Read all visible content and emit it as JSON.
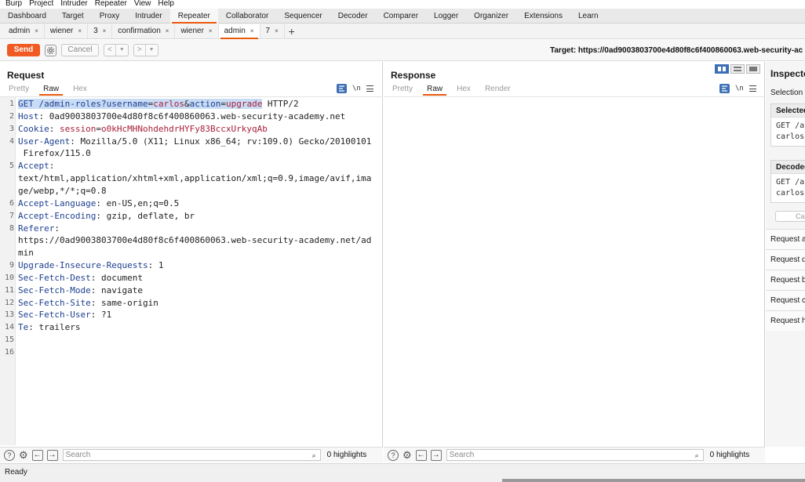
{
  "menu": [
    "Burp",
    "Project",
    "Intruder",
    "Repeater",
    "View",
    "Help"
  ],
  "main_tabs": [
    {
      "label": "Dashboard"
    },
    {
      "label": "Target"
    },
    {
      "label": "Proxy"
    },
    {
      "label": "Intruder"
    },
    {
      "label": "Repeater",
      "active": true
    },
    {
      "label": "Collaborator"
    },
    {
      "label": "Sequencer"
    },
    {
      "label": "Decoder"
    },
    {
      "label": "Comparer"
    },
    {
      "label": "Logger"
    },
    {
      "label": "Organizer"
    },
    {
      "label": "Extensions"
    },
    {
      "label": "Learn"
    }
  ],
  "sub_tabs": [
    {
      "label": "admin"
    },
    {
      "label": "wiener"
    },
    {
      "label": "3"
    },
    {
      "label": "confirmation"
    },
    {
      "label": "wiener"
    },
    {
      "label": "admin",
      "active": true
    },
    {
      "label": "7"
    }
  ],
  "toolbar": {
    "send_label": "Send",
    "cancel_label": "Cancel",
    "target_label": "Target: https://0ad9003803700e4d80f8c6f400860063.web-security-ac"
  },
  "request": {
    "title": "Request",
    "tabs": [
      "Pretty",
      "Raw",
      "Hex"
    ],
    "active_tab": "Raw",
    "lines": [
      {
        "n": "1",
        "parts": [
          {
            "t": "GET /admin-roles?",
            "c": "sel-key"
          },
          {
            "t": "username",
            "c": "sel-key"
          },
          {
            "t": "=",
            "c": "sel"
          },
          {
            "t": "carlos",
            "c": "sel-param"
          },
          {
            "t": "&",
            "c": "sel"
          },
          {
            "t": "action",
            "c": "sel-key"
          },
          {
            "t": "=",
            "c": "sel"
          },
          {
            "t": "upgrade",
            "c": "sel-param"
          },
          {
            "t": " HTTP/2",
            "c": "val"
          }
        ]
      },
      {
        "n": "2",
        "parts": [
          {
            "t": "Host",
            "c": "key"
          },
          {
            "t": ": 0ad9003803700e4d80f8c6f400860063.web-security-academy.net",
            "c": "val"
          }
        ]
      },
      {
        "n": "3",
        "parts": [
          {
            "t": "Cookie",
            "c": "key"
          },
          {
            "t": ": ",
            "c": "val"
          },
          {
            "t": "session",
            "c": "cookie"
          },
          {
            "t": "=",
            "c": "val"
          },
          {
            "t": "o0kHcMHNohdehdrHYFy83BccxUrkyqAb",
            "c": "cookie"
          }
        ]
      },
      {
        "n": "4",
        "parts": [
          {
            "t": "User-Agent",
            "c": "key"
          },
          {
            "t": ": Mozilla/5.0 (X11; Linux x86_64; rv:109.0) Gecko/20100101",
            "c": "val"
          }
        ]
      },
      {
        "n": "",
        "parts": [
          {
            "t": " Firefox/115.0",
            "c": "val"
          }
        ]
      },
      {
        "n": "5",
        "parts": [
          {
            "t": "Accept",
            "c": "key"
          },
          {
            "t": ":",
            "c": "val"
          }
        ]
      },
      {
        "n": "",
        "parts": [
          {
            "t": "text/html,application/xhtml+xml,application/xml;q=0.9,image/avif,ima",
            "c": "val"
          }
        ]
      },
      {
        "n": "",
        "parts": [
          {
            "t": "ge/webp,*/*;q=0.8",
            "c": "val"
          }
        ]
      },
      {
        "n": "6",
        "parts": [
          {
            "t": "Accept-Language",
            "c": "key"
          },
          {
            "t": ": en-US,en;q=0.5",
            "c": "val"
          }
        ]
      },
      {
        "n": "7",
        "parts": [
          {
            "t": "Accept-Encoding",
            "c": "key"
          },
          {
            "t": ": gzip, deflate, br",
            "c": "val"
          }
        ]
      },
      {
        "n": "8",
        "parts": [
          {
            "t": "Referer",
            "c": "key"
          },
          {
            "t": ":",
            "c": "val"
          }
        ]
      },
      {
        "n": "",
        "parts": [
          {
            "t": "https://0ad9003803700e4d80f8c6f400860063.web-security-academy.net/ad",
            "c": "val"
          }
        ]
      },
      {
        "n": "",
        "parts": [
          {
            "t": "min",
            "c": "val"
          }
        ]
      },
      {
        "n": "9",
        "parts": [
          {
            "t": "Upgrade-Insecure-Requests",
            "c": "key"
          },
          {
            "t": ": 1",
            "c": "val"
          }
        ]
      },
      {
        "n": "10",
        "parts": [
          {
            "t": "Sec-Fetch-Dest",
            "c": "key"
          },
          {
            "t": ": document",
            "c": "val"
          }
        ]
      },
      {
        "n": "11",
        "parts": [
          {
            "t": "Sec-Fetch-Mode",
            "c": "key"
          },
          {
            "t": ": navigate",
            "c": "val"
          }
        ]
      },
      {
        "n": "12",
        "parts": [
          {
            "t": "Sec-Fetch-Site",
            "c": "key"
          },
          {
            "t": ": same-origin",
            "c": "val"
          }
        ]
      },
      {
        "n": "13",
        "parts": [
          {
            "t": "Sec-Fetch-User",
            "c": "key"
          },
          {
            "t": ": ?1",
            "c": "val"
          }
        ]
      },
      {
        "n": "14",
        "parts": [
          {
            "t": "Te",
            "c": "key"
          },
          {
            "t": ": trailers",
            "c": "val"
          }
        ]
      },
      {
        "n": "15",
        "parts": []
      },
      {
        "n": "16",
        "parts": []
      }
    ],
    "search_placeholder": "Search",
    "highlights": "0 highlights"
  },
  "response": {
    "title": "Response",
    "tabs": [
      "Pretty",
      "Raw",
      "Hex",
      "Render"
    ],
    "active_tab": "Raw",
    "search_placeholder": "Search",
    "highlights": "0 highlights"
  },
  "inspector": {
    "title": "Inspector",
    "selection_label": "Selection",
    "selected_header": "Selected",
    "selected_lines": [
      "GET /a",
      "carlos"
    ],
    "decoded_header": "Decoded",
    "decoded_lines": [
      "GET /a",
      "carlos"
    ],
    "cancel_label": "Ca",
    "sections": [
      "Request at",
      "Request q",
      "Request bo",
      "Request co",
      "Request h"
    ]
  },
  "status": {
    "text": "Ready"
  },
  "colors": {
    "accent": "#f15a22",
    "tab_underline": "#e8590c",
    "selection": "#c9dcf5",
    "header_key": "#1d3f8f",
    "param_value": "#a8203a"
  }
}
